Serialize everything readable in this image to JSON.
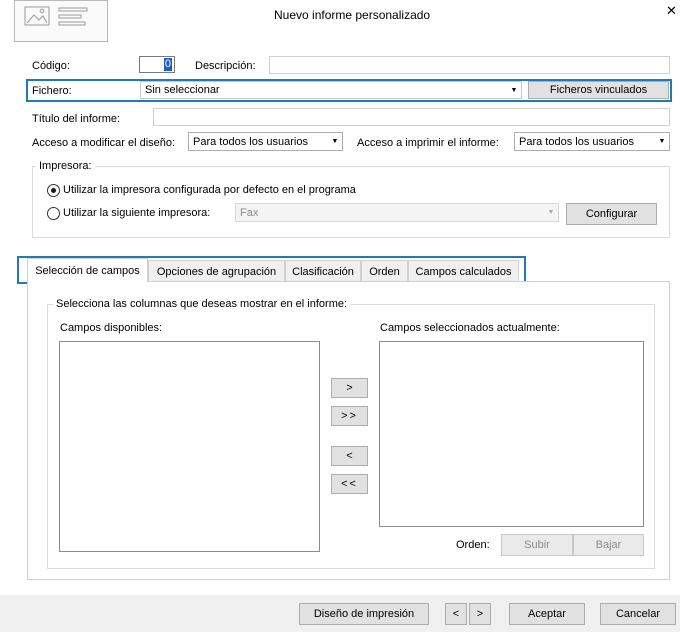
{
  "window": {
    "title": "Nuevo informe personalizado",
    "close_glyph": "✕"
  },
  "form": {
    "codigo_label": "Código:",
    "codigo_value": "0",
    "descripcion_label": "Descripción:",
    "descripcion_value": "",
    "fichero_label": "Fichero:",
    "fichero_value": "Sin seleccionar",
    "ficheros_vinculados_button": "Ficheros vinculados",
    "titulo_label": "Título del informe:",
    "titulo_value": "",
    "acceso_modificar_label": "Acceso a modificar el diseño:",
    "acceso_modificar_value": "Para todos los usuarios",
    "acceso_imprimir_label": "Acceso a imprimir el informe:",
    "acceso_imprimir_value": "Para todos los usuarios"
  },
  "printer": {
    "group_title": "Impresora:",
    "option_default": "Utilizar la impresora configurada por defecto en el programa",
    "option_custom": "Utilizar la siguiente impresora:",
    "printer_value": "Fax",
    "configure_button": "Configurar",
    "selected": "default"
  },
  "tabs": [
    {
      "label": "Selección de campos",
      "active": true
    },
    {
      "label": "Opciones de agrupación",
      "active": false
    },
    {
      "label": "Clasificación",
      "active": false
    },
    {
      "label": "Orden",
      "active": false
    },
    {
      "label": "Campos calculados",
      "active": false
    }
  ],
  "fields_panel": {
    "group_title": "Selecciona las columnas que deseas mostrar en el informe:",
    "available_label": "Campos disponibles:",
    "selected_label": "Campos seleccionados actualmente:",
    "add_one": ">",
    "add_all": ">>",
    "remove_one": "<",
    "remove_all": "<<",
    "order_label": "Orden:",
    "up_button": "Subir",
    "down_button": "Bajar"
  },
  "footer": {
    "print_design_button": "Diseño de impresión",
    "prev_button": "<",
    "next_button": ">",
    "accept_button": "Aceptar",
    "cancel_button": "Cancelar"
  },
  "colors": {
    "highlight_border": "#1f7ab8",
    "focus_cursor": "#1f5fbf",
    "footer_bg": "#f0f0f0"
  },
  "icons": {
    "report_thumbnail": "report-template-icon",
    "dropdown": "chevron-down-icon",
    "close": "close-icon"
  }
}
